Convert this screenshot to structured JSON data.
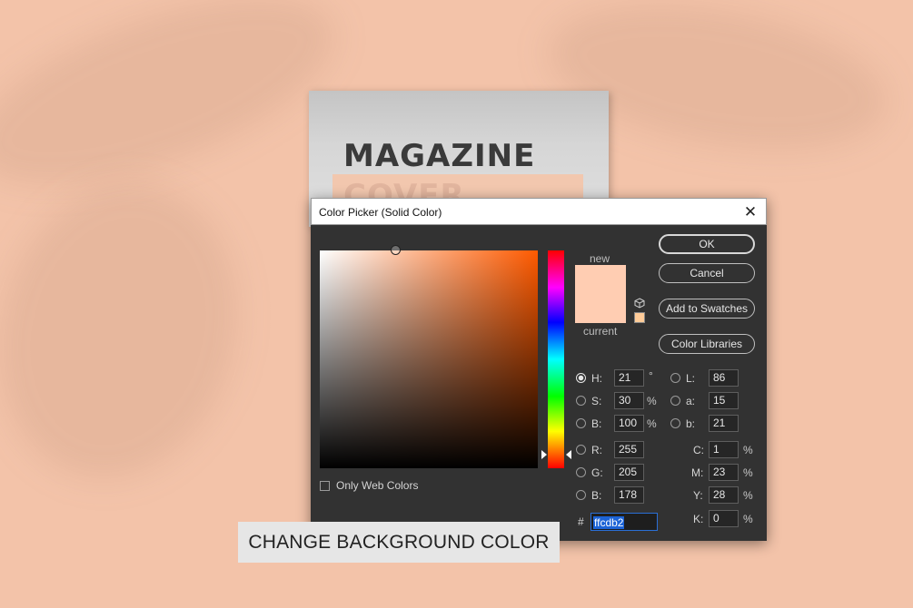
{
  "magazine": {
    "title": "MAGAZINE",
    "cover_text": "COVER"
  },
  "dialog": {
    "title": "Color Picker (Solid Color)",
    "labels": {
      "new": "new",
      "current": "current"
    },
    "buttons": {
      "ok": "OK",
      "cancel": "Cancel",
      "add_to_swatches": "Add to Swatches",
      "color_libraries": "Color Libraries"
    },
    "only_web_colors": "Only Web Colors",
    "hsb": [
      {
        "label": "H:",
        "value": "21",
        "unit": "°",
        "checked": true
      },
      {
        "label": "S:",
        "value": "30",
        "unit": "%",
        "checked": false
      },
      {
        "label": "B:",
        "value": "100",
        "unit": "%",
        "checked": false
      }
    ],
    "rgb": [
      {
        "label": "R:",
        "value": "255"
      },
      {
        "label": "G:",
        "value": "205"
      },
      {
        "label": "B:",
        "value": "178"
      }
    ],
    "lab": [
      {
        "label": "L:",
        "value": "86"
      },
      {
        "label": "a:",
        "value": "15"
      },
      {
        "label": "b:",
        "value": "21"
      }
    ],
    "cmyk": [
      {
        "label": "C:",
        "value": "1",
        "unit": "%"
      },
      {
        "label": "M:",
        "value": "23",
        "unit": "%"
      },
      {
        "label": "Y:",
        "value": "28",
        "unit": "%"
      },
      {
        "label": "K:",
        "value": "0",
        "unit": "%"
      }
    ],
    "hex_label": "#",
    "hex_value": "ffcdb2"
  },
  "caption": "CHANGE BACKGROUND COLOR",
  "colors": {
    "background": "#f3c3a9",
    "new_color": "#ffcdb2",
    "dialog_bg": "#323232",
    "selection_blue": "#1c63d6"
  },
  "icons": [
    "close-icon",
    "cube-icon",
    "hue-slider-arrow-icon",
    "field-cursor-icon"
  ]
}
